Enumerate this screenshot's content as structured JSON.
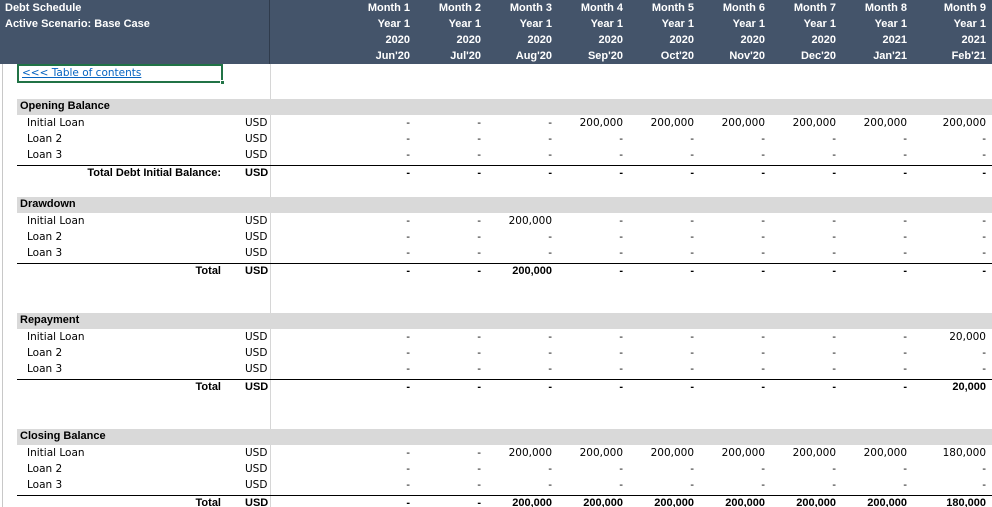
{
  "header": {
    "title": "Debt Schedule",
    "scenario": "Active Scenario: Base Case",
    "columns": [
      {
        "month": "Month 1",
        "year": "Year 1",
        "cal_year": "2020",
        "label": "Jun'20"
      },
      {
        "month": "Month 2",
        "year": "Year 1",
        "cal_year": "2020",
        "label": "Jul'20"
      },
      {
        "month": "Month 3",
        "year": "Year 1",
        "cal_year": "2020",
        "label": "Aug'20"
      },
      {
        "month": "Month 4",
        "year": "Year 1",
        "cal_year": "2020",
        "label": "Sep'20"
      },
      {
        "month": "Month 5",
        "year": "Year 1",
        "cal_year": "2020",
        "label": "Oct'20"
      },
      {
        "month": "Month 6",
        "year": "Year 1",
        "cal_year": "2020",
        "label": "Nov'20"
      },
      {
        "month": "Month 7",
        "year": "Year 1",
        "cal_year": "2020",
        "label": "Dec'20"
      },
      {
        "month": "Month 8",
        "year": "Year 1",
        "cal_year": "2021",
        "label": "Jan'21"
      },
      {
        "month": "Month 9",
        "year": "Year 1",
        "cal_year": "2021",
        "label": "Feb'21"
      }
    ]
  },
  "toc_link": "<<< Table of contents",
  "sections": [
    {
      "title": "Opening Balance",
      "rows": [
        {
          "label": "Initial Loan",
          "unit": "USD",
          "values": [
            "-",
            "-",
            "-",
            "200,000",
            "200,000",
            "200,000",
            "200,000",
            "200,000",
            "200,000"
          ]
        },
        {
          "label": "Loan 2",
          "unit": "USD",
          "values": [
            "-",
            "-",
            "-",
            "-",
            "-",
            "-",
            "-",
            "-",
            "-"
          ]
        },
        {
          "label": "Loan 3",
          "unit": "USD",
          "values": [
            "-",
            "-",
            "-",
            "-",
            "-",
            "-",
            "-",
            "-",
            "-"
          ]
        }
      ],
      "total": {
        "label": "Total Debt Initial Balance:",
        "unit": "USD",
        "values": [
          "-",
          "-",
          "-",
          "-",
          "-",
          "-",
          "-",
          "-",
          "-"
        ]
      }
    },
    {
      "title": "Drawdown",
      "rows": [
        {
          "label": "Initial Loan",
          "unit": "USD",
          "values": [
            "-",
            "-",
            "200,000",
            "-",
            "-",
            "-",
            "-",
            "-",
            "-"
          ]
        },
        {
          "label": "Loan 2",
          "unit": "USD",
          "values": [
            "-",
            "-",
            "-",
            "-",
            "-",
            "-",
            "-",
            "-",
            "-"
          ]
        },
        {
          "label": "Loan 3",
          "unit": "USD",
          "values": [
            "-",
            "-",
            "-",
            "-",
            "-",
            "-",
            "-",
            "-",
            "-"
          ]
        }
      ],
      "total": {
        "label": "Total",
        "unit": "USD",
        "values": [
          "-",
          "-",
          "200,000",
          "-",
          "-",
          "-",
          "-",
          "-",
          "-"
        ]
      }
    },
    {
      "title": "Repayment",
      "rows": [
        {
          "label": "Initial Loan",
          "unit": "USD",
          "values": [
            "-",
            "-",
            "-",
            "-",
            "-",
            "-",
            "-",
            "-",
            "20,000"
          ]
        },
        {
          "label": "Loan 2",
          "unit": "USD",
          "values": [
            "-",
            "-",
            "-",
            "-",
            "-",
            "-",
            "-",
            "-",
            "-"
          ]
        },
        {
          "label": "Loan 3",
          "unit": "USD",
          "values": [
            "-",
            "-",
            "-",
            "-",
            "-",
            "-",
            "-",
            "-",
            "-"
          ]
        }
      ],
      "total": {
        "label": "Total",
        "unit": "USD",
        "values": [
          "-",
          "-",
          "-",
          "-",
          "-",
          "-",
          "-",
          "-",
          "20,000"
        ]
      }
    },
    {
      "title": "Closing Balance",
      "rows": [
        {
          "label": "Initial Loan",
          "unit": "USD",
          "values": [
            "-",
            "-",
            "200,000",
            "200,000",
            "200,000",
            "200,000",
            "200,000",
            "200,000",
            "180,000"
          ]
        },
        {
          "label": "Loan 2",
          "unit": "USD",
          "values": [
            "-",
            "-",
            "-",
            "-",
            "-",
            "-",
            "-",
            "-",
            "-"
          ]
        },
        {
          "label": "Loan 3",
          "unit": "USD",
          "values": [
            "-",
            "-",
            "-",
            "-",
            "-",
            "-",
            "-",
            "-",
            "-"
          ]
        }
      ],
      "total": {
        "label": "Total",
        "unit": "USD",
        "values": [
          "-",
          "-",
          "200,000",
          "200,000",
          "200,000",
          "200,000",
          "200,000",
          "200,000",
          "180,000"
        ]
      }
    }
  ],
  "colors": {
    "header_bg": "#44546a",
    "section_bg": "#d9d9d9",
    "link": "#0563c1",
    "selection": "#217346"
  }
}
